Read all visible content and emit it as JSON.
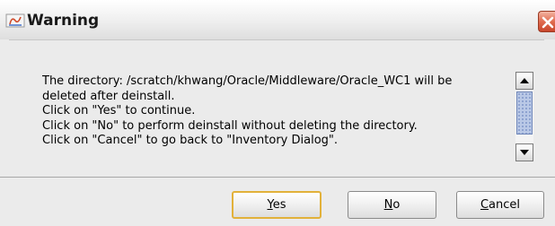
{
  "dialog": {
    "title": "Warning",
    "icon": "java-warning-icon",
    "close_icon": "close-icon"
  },
  "message": {
    "lines": [
      "The directory: /scratch/khwang/Oracle/Middleware/Oracle_WC1 will be",
      "deleted after deinstall.",
      "Click on \"Yes\" to continue.",
      "Click on \"No\" to perform deinstall without deleting the directory.",
      "Click on \"Cancel\" to go back to \"Inventory Dialog\"."
    ]
  },
  "buttons": {
    "yes": {
      "mnemonic": "Y",
      "rest": "es"
    },
    "no": {
      "mnemonic": "N",
      "rest": "o"
    },
    "cancel": {
      "mnemonic": "C",
      "rest": "ancel"
    }
  },
  "colors": {
    "close_button": "#e06b4f",
    "default_button_border": "#e2b13a",
    "scroll_thumb": "#b9c8e6"
  }
}
